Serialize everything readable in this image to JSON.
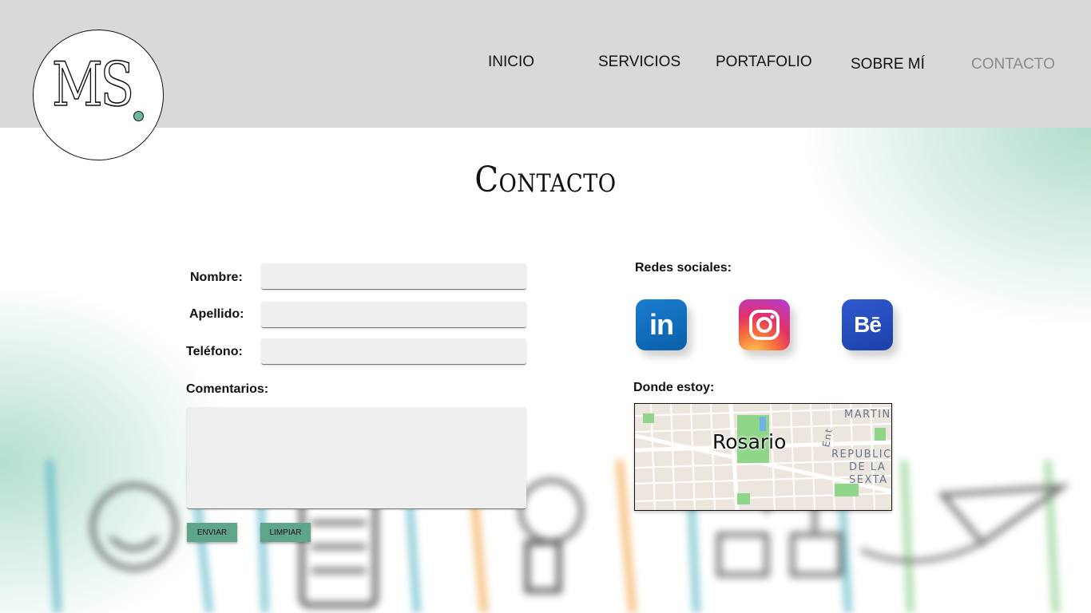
{
  "header": {
    "logo_text": "MS",
    "nav": [
      {
        "label": "INICIO",
        "active": false
      },
      {
        "label": "SERVICIOS",
        "active": false
      },
      {
        "label": "PORTAFOLIO",
        "active": false
      },
      {
        "label": "SOBRE MÍ",
        "active": false
      },
      {
        "label": "CONTACTO",
        "active": true
      }
    ]
  },
  "page_title": "Contacto",
  "form": {
    "nombre_label": "Nombre:",
    "apellido_label": "Apellido:",
    "telefono_label": "Teléfono:",
    "comentarios_label": "Comentarios:",
    "nombre_value": "",
    "apellido_value": "",
    "telefono_value": "",
    "comentarios_value": "",
    "submit_label": "ENVIAR",
    "clear_label": "LIMPIAR"
  },
  "social": {
    "heading": "Redes sociales:",
    "items": [
      {
        "name": "linkedin",
        "icon": "linkedin-icon",
        "glyph": "in",
        "color": "#0a66c2"
      },
      {
        "name": "instagram",
        "icon": "instagram-icon",
        "glyph": "",
        "color": "#e1306c"
      },
      {
        "name": "behance",
        "icon": "behance-icon",
        "glyph": "Bē",
        "color": "#1f4ab8"
      }
    ]
  },
  "location": {
    "heading": "Donde estoy:",
    "city": "Rosario",
    "map_labels": {
      "district_top": "MARTIN",
      "district_line1": "REPUBLIC",
      "district_line2": "DE LA",
      "district_line3": "SEXTA",
      "street": "Ent"
    }
  },
  "colors": {
    "header_bg": "#d9d9d9",
    "accent_green": "#5fa58a",
    "nav_active": "#8a8a8a"
  }
}
